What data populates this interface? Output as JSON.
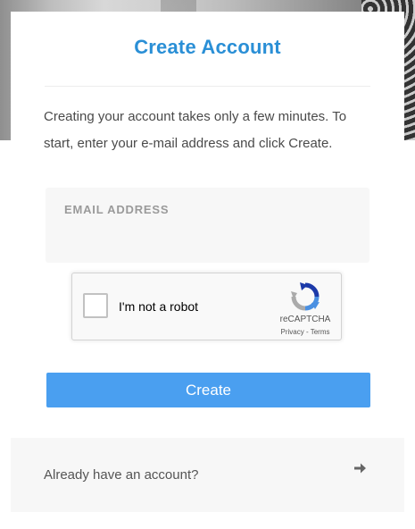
{
  "page": {
    "title": "Create Account",
    "intro": "Creating your account takes only a few minutes. To start, enter your e-mail address and click Create."
  },
  "email": {
    "label": "EMAIL ADDRESS",
    "value": "",
    "placeholder": ""
  },
  "captcha": {
    "label": "I'm not a robot",
    "brand": "reCAPTCHA",
    "links": "Privacy - Terms",
    "icon": "recaptcha-icon",
    "checked": false
  },
  "actions": {
    "create_label": "Create"
  },
  "footer": {
    "signin_text": "Already have an account?",
    "icon": "arrow-right-icon"
  },
  "colors": {
    "title": "#2a8fd6",
    "button": "#4a9ff0",
    "panel": "#f7f7f7"
  }
}
